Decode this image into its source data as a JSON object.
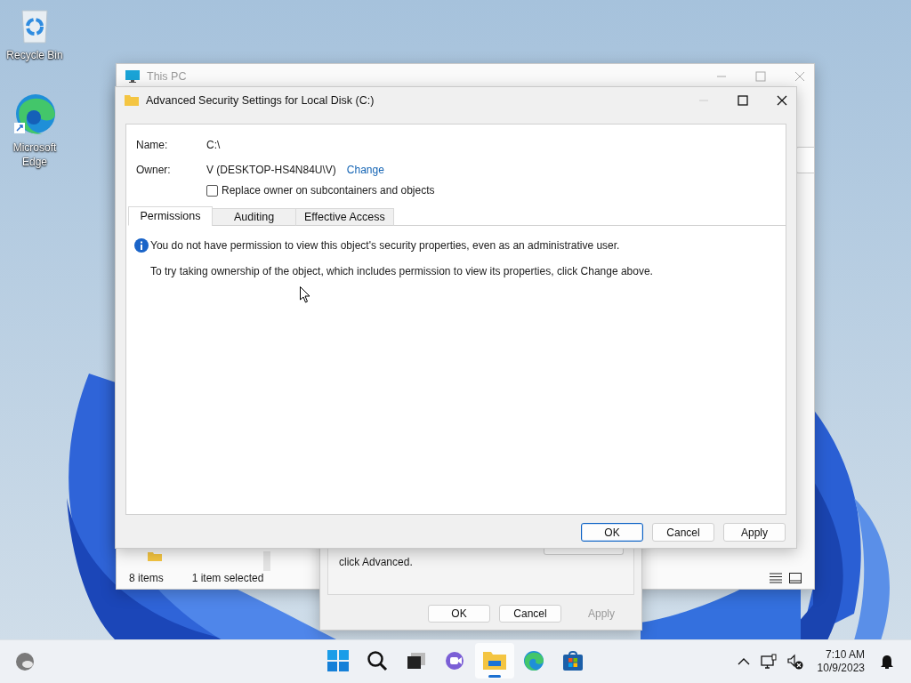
{
  "desktop_icons": [
    {
      "kind": "recycle-bin",
      "label": "Recycle Bin"
    },
    {
      "kind": "edge",
      "label": "Microsoft Edge"
    }
  ],
  "explorer_window": {
    "title": "This PC",
    "status_bar": {
      "item_count": "8 items",
      "selection": "1 item selected"
    }
  },
  "properties_dialog": {
    "text": "click Advanced.",
    "buttons": [
      {
        "label": "OK",
        "disabled": false
      },
      {
        "label": "Cancel",
        "disabled": false
      },
      {
        "label": "Apply",
        "disabled": true
      }
    ]
  },
  "security_window": {
    "title": "Advanced Security Settings for Local Disk (C:)",
    "fields": [
      {
        "label": "Name:",
        "value": "C:\\"
      },
      {
        "label": "Owner:",
        "value": "V (DESKTOP-HS4N84U\\V)",
        "link": "Change"
      }
    ],
    "checkbox": {
      "label": "Replace owner on subcontainers and objects",
      "checked": false
    },
    "tabs": [
      {
        "label": "Permissions",
        "selected": true
      },
      {
        "label": "Auditing",
        "selected": false
      },
      {
        "label": "Effective Access",
        "selected": false
      }
    ],
    "message": "You do not have permission to view this object's security properties, even as an administrative user.",
    "hint": "To try taking ownership of the object, which includes permission to view its properties, click Change above.",
    "buttons": [
      {
        "label": "OK",
        "default": true
      },
      {
        "label": "Cancel",
        "default": false
      },
      {
        "label": "Apply",
        "default": false
      }
    ]
  },
  "taskbar": {
    "apps": [
      {
        "kind": "start",
        "active": false
      },
      {
        "kind": "search",
        "active": false
      },
      {
        "kind": "task-view",
        "active": false
      },
      {
        "kind": "chat",
        "active": false
      },
      {
        "kind": "explorer",
        "active": true
      },
      {
        "kind": "edge",
        "active": false
      },
      {
        "kind": "store",
        "active": false
      }
    ],
    "time": "7:10 AM",
    "date": "10/9/2023"
  }
}
